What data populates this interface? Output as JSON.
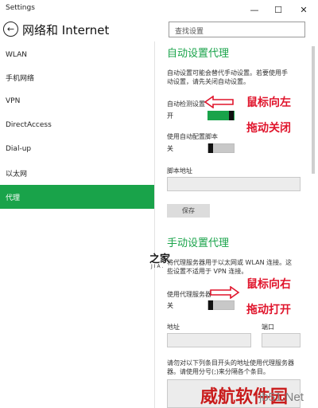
{
  "window": {
    "title": "Settings",
    "buttons": {
      "minimize": "—",
      "maximize": "☐",
      "close": "✕"
    }
  },
  "header": {
    "title": "网络和 Internet",
    "search_placeholder": "查找设置"
  },
  "sidebar": {
    "items": [
      {
        "label": "WLAN",
        "active": false
      },
      {
        "label": "手机网络",
        "active": false
      },
      {
        "label": "VPN",
        "active": false
      },
      {
        "label": "DirectAccess",
        "active": false
      },
      {
        "label": "Dial-up",
        "active": false
      },
      {
        "label": "以太网",
        "active": false
      },
      {
        "label": "代理",
        "active": true
      }
    ]
  },
  "auto_proxy": {
    "title": "自动设置代理",
    "desc_line1": "自动设置可能会替代手动设置。若要使用手",
    "desc_line2": "动设置，请先关闭自动设置。",
    "detect_label": "自动检测设置",
    "detect_state": "开",
    "detect_on": true,
    "script_label": "使用自动配置脚本",
    "script_state": "关",
    "script_on": false,
    "address_label": "脚本地址",
    "address_value": "",
    "save_label": "保存"
  },
  "manual_proxy": {
    "title": "手动设置代理",
    "desc_line1": "将代理服务器用于以太网或 WLAN 连接。这",
    "desc_line2": "些设置不适用于 VPN 连接。",
    "use_label": "使用代理服务器",
    "use_state": "关",
    "use_on": false,
    "address_label": "地址",
    "port_label": "端口",
    "address_value": "",
    "port_value": "",
    "exceptions_line1": "请勿对以下列条目开头的地址使用代理服务器",
    "exceptions_line2": "器。请使用分号(;)来分隔各个条目。"
  },
  "annotations": {
    "note1_line1": "鼠标向左",
    "note1_line2": "拖动关闭",
    "note2_line1": "鼠标向右",
    "note2_line2": "拖动打开",
    "color": "#e0152c"
  },
  "watermarks": {
    "logo_text": "之家",
    "logo_sub": "JIA.",
    "site_name": "威航软件园",
    "url": "jb51.Net"
  },
  "colors": {
    "accent": "#19a34a",
    "annotation": "#e0152c"
  }
}
